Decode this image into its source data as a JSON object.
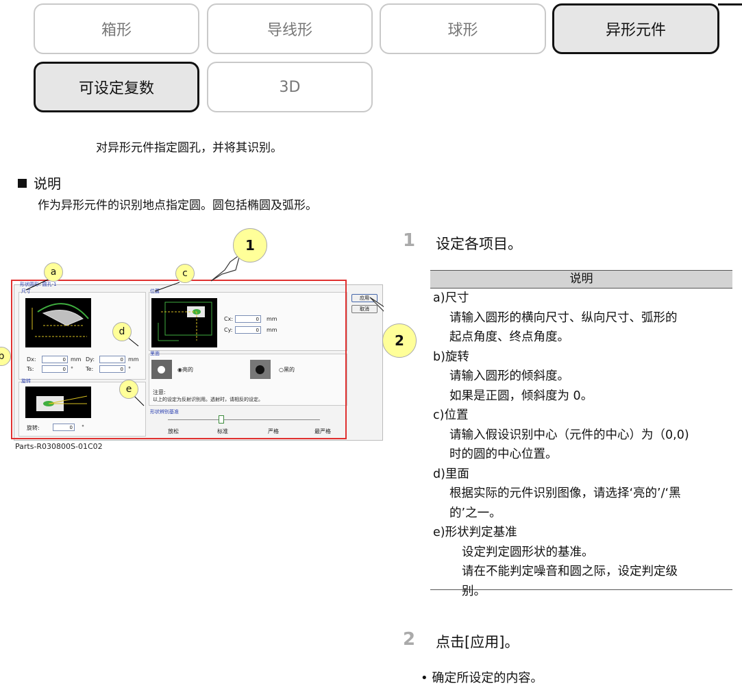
{
  "tabs": [
    {
      "label": "箱形",
      "active": false
    },
    {
      "label": "导线形",
      "active": false
    },
    {
      "label": "球形",
      "active": false
    },
    {
      "label": "异形元件",
      "active": true
    },
    {
      "label": "可设定复数",
      "active": true
    },
    {
      "label": "3D",
      "active": false
    }
  ],
  "intro": "对异形元件指定圆孔，并将其识别。",
  "section": {
    "title": "说明",
    "body": "作为异形元件的识别地点指定圆。圆包括椭圆及弧形。"
  },
  "figure": {
    "caption": "Parts-R030800S-01C02",
    "callouts": {
      "c1": "1",
      "c2": "2",
      "a": "a",
      "b": "b",
      "c": "c",
      "d": "d",
      "e": "e"
    },
    "dialog": {
      "group_title": "形状圆形: 圆孔-1",
      "size_title": "尺寸",
      "dx_label": "Dx:",
      "dx_value": "0",
      "dx_unit": "mm",
      "dy_label": "Dy:",
      "dy_value": "0",
      "dy_unit": "mm",
      "ts_label": "Ts:",
      "ts_value": "0",
      "ts_unit": "°",
      "te_label": "Te:",
      "te_value": "0",
      "te_unit": "°",
      "rotation_title": "旋转",
      "rot_label": "旋转:",
      "rot_value": "0",
      "rot_unit": "°",
      "position_title": "位置",
      "cx_label": "Cx:",
      "cx_value": "0",
      "cx_unit": "mm",
      "cy_label": "Cy:",
      "cy_value": "0",
      "cy_unit": "mm",
      "surface_title": "里面",
      "bright_label": "亮的",
      "dark_label": "黑的",
      "note_title": "注意:",
      "note_text": "以上的设定为反射识别用。透射时，请相反的设定。",
      "shape_title": "形状辨别基准",
      "levels": [
        "放松",
        "标准",
        "严格",
        "最严格"
      ],
      "apply_btn": "应用",
      "cancel_btn": "取消"
    }
  },
  "steps": [
    {
      "num": "1",
      "text": "设定各项目。"
    },
    {
      "num": "2",
      "text": "点击[应用]。"
    }
  ],
  "desc": {
    "header": "说明",
    "lines": [
      {
        "text": "a)尺寸",
        "indent": 0
      },
      {
        "text": "请输入圆形的横向尺寸、纵向尺寸、弧形的",
        "indent": 1
      },
      {
        "text": "起点角度、终点角度。",
        "indent": 1
      },
      {
        "text": "b)旋转",
        "indent": 0
      },
      {
        "text": "请输入圆形的倾斜度。",
        "indent": 1
      },
      {
        "text": "如果是正圆，倾斜度为 0。",
        "indent": 1
      },
      {
        "text": "c)位置",
        "indent": 0
      },
      {
        "text": "请输入假设识别中心（元件的中心）为（0,0)",
        "indent": 1
      },
      {
        "text": "时的圆的中心位置。",
        "indent": 1
      },
      {
        "text": "d)里面",
        "indent": 0
      },
      {
        "text": "根据实际的元件识别图像，请选择‘亮的’/‘黑",
        "indent": 1
      },
      {
        "text": "的’之一。",
        "indent": 1
      },
      {
        "text": "e)形状判定基准",
        "indent": 0
      },
      {
        "text": "设定判定圆形状的基准。",
        "indent": 2
      },
      {
        "text": "请在不能判定噪音和圆之际，设定判定级",
        "indent": 2
      },
      {
        "text": "别。",
        "indent": 2
      }
    ]
  },
  "bullet": "• 确定所设定的内容。"
}
